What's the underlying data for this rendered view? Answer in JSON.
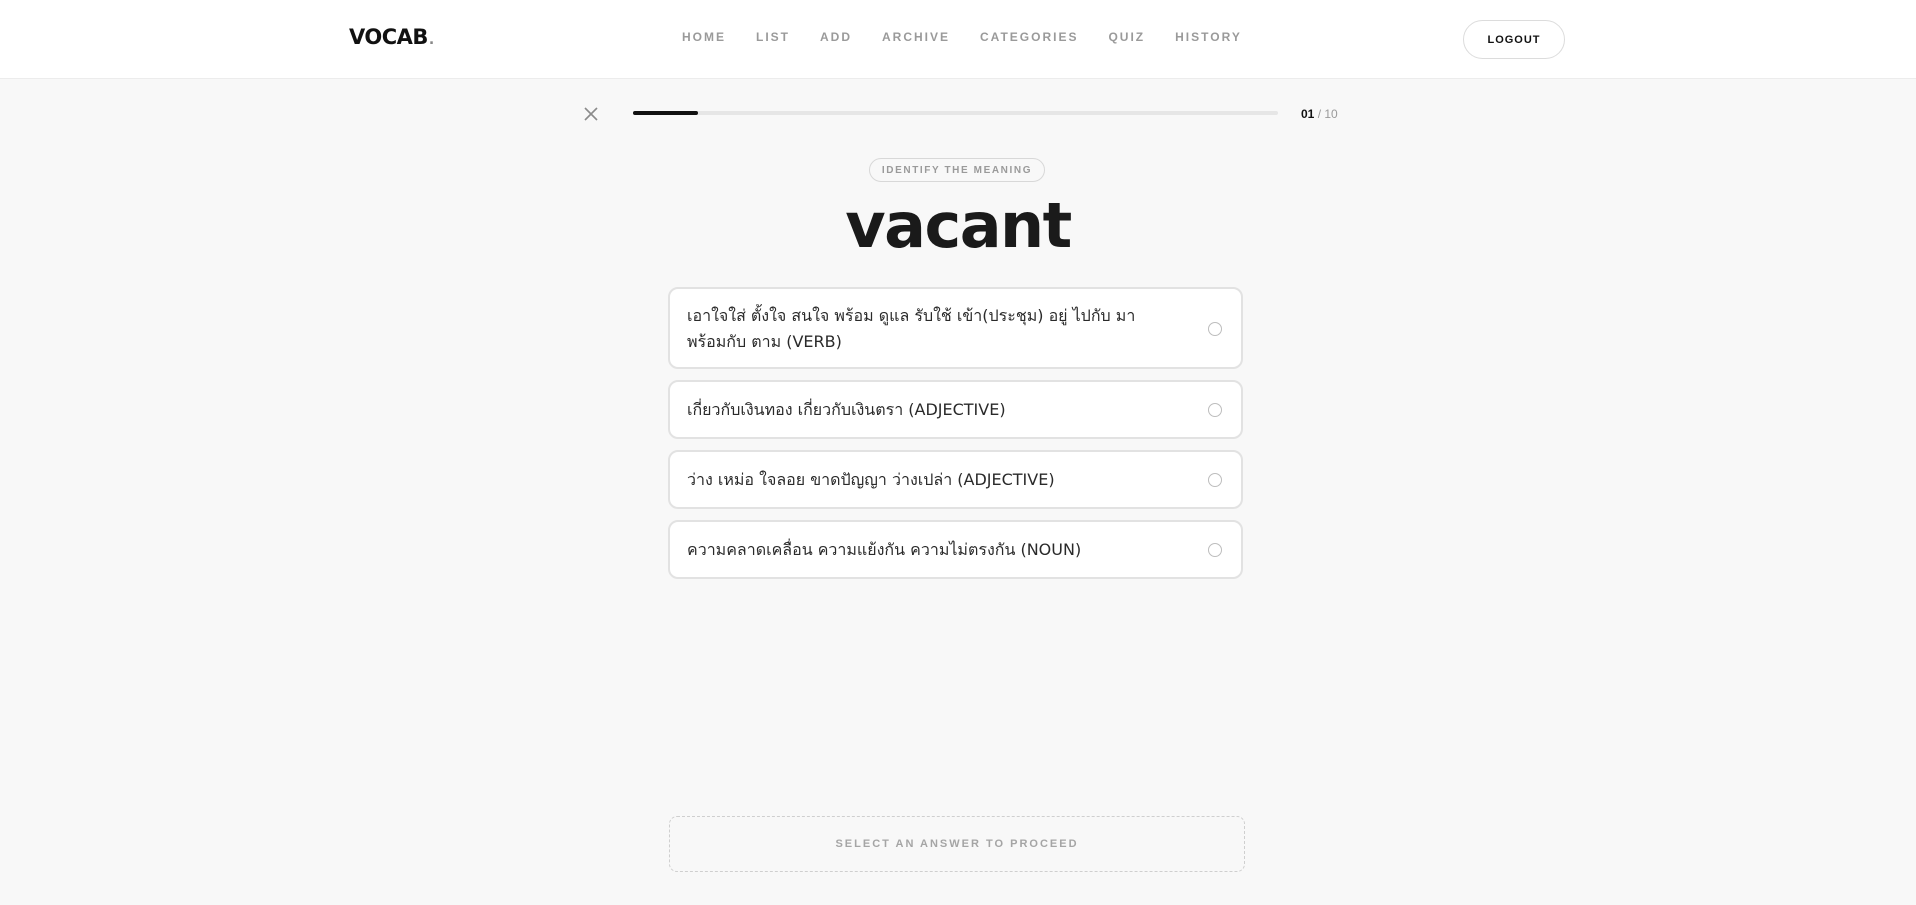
{
  "header": {
    "logo": "VOCAB",
    "logo_dot": ".",
    "nav": [
      "HOME",
      "LIST",
      "ADD",
      "ARCHIVE",
      "CATEGORIES",
      "QUIZ",
      "HISTORY"
    ],
    "logout_label": "LOGOUT"
  },
  "quiz": {
    "progress_fraction": 0.1,
    "counter_current": "01",
    "counter_sep": " / ",
    "counter_total": "10",
    "prompt_label": "IDENTIFY THE MEANING",
    "word": "vacant",
    "options": [
      "เอาใจใส่ ตั้งใจ สนใจ พร้อม ดูแล รับใช้ เข้า(ประชุม) อยู่ ไปกับ มาพร้อมกับ ตาม (VERB)",
      "เกี่ยวกับเงินทอง เกี่ยวกับเงินตรา (ADJECTIVE)",
      "ว่าง เหม่อ ใจลอย ขาดปัญญา ว่างเปล่า (ADJECTIVE)",
      "ความคลาดเคลื่อน ความแย้งกัน ความไม่ตรงกัน (NOUN)"
    ],
    "proceed_label": "SELECT AN ANSWER TO PROCEED"
  },
  "icons": {
    "close": "close-icon",
    "radio": "radio-icon"
  }
}
